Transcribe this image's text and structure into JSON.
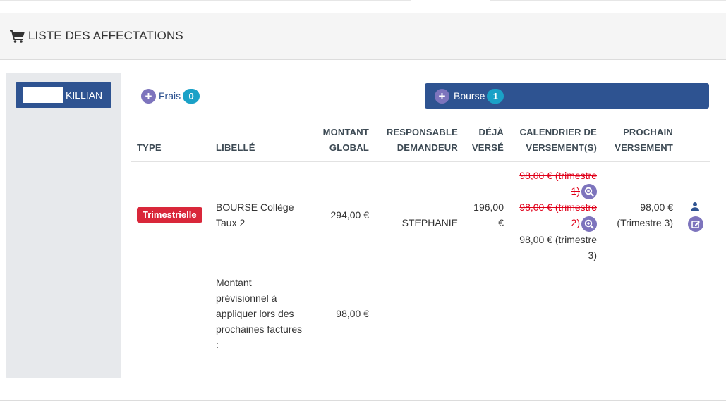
{
  "header": {
    "title": "LISTE DES AFFECTATIONS",
    "icon": "shopping-cart-icon"
  },
  "student": {
    "name": "KILLIAN"
  },
  "frais": {
    "label": "Frais",
    "count": "0"
  },
  "bourse": {
    "label": "Bourse",
    "count": "1"
  },
  "table": {
    "headers": {
      "type": "TYPE",
      "libelle": "LIBELLÉ",
      "montant_1": "MONTANT",
      "montant_2": "GLOBAL",
      "responsable_1": "RESPONSABLE",
      "responsable_2": "DEMANDEUR",
      "deja_1": "DÉJÀ",
      "deja_2": "VERSÉ",
      "calendrier_1": "CALENDRIER DE",
      "calendrier_2": "VERSEMENT(S)",
      "prochain_1": "PROCHAIN",
      "prochain_2": "VERSEMENT"
    },
    "row1": {
      "type": "Trimestrielle",
      "libelle_1": "BOURSE Collège",
      "libelle_2": "Taux 2",
      "montant": "294,00 €",
      "responsable": "STEPHANIE",
      "deja_1": "196,00",
      "deja_2": "€",
      "calendar": [
        {
          "line1": "98,00 € (trimestre",
          "line2": "1)",
          "paid": true
        },
        {
          "line1": "98,00 € (trimestre",
          "line2": "2)",
          "paid": true
        },
        {
          "line1": "98,00 € (trimestre",
          "line2": "3)",
          "paid": false
        }
      ],
      "prochain_1": "98,00 €",
      "prochain_2": "(Trimestre 3)"
    },
    "row2": {
      "libelle_lines": [
        "Montant",
        "prévisionnel à",
        "appliquer lors des",
        "prochaines factures",
        ":"
      ],
      "montant": "98,00 €"
    }
  },
  "colors": {
    "primary": "#2e5391",
    "accent_purple": "#7d74bd",
    "badge_cyan": "#1aa1c7",
    "danger": "#d9273a"
  }
}
